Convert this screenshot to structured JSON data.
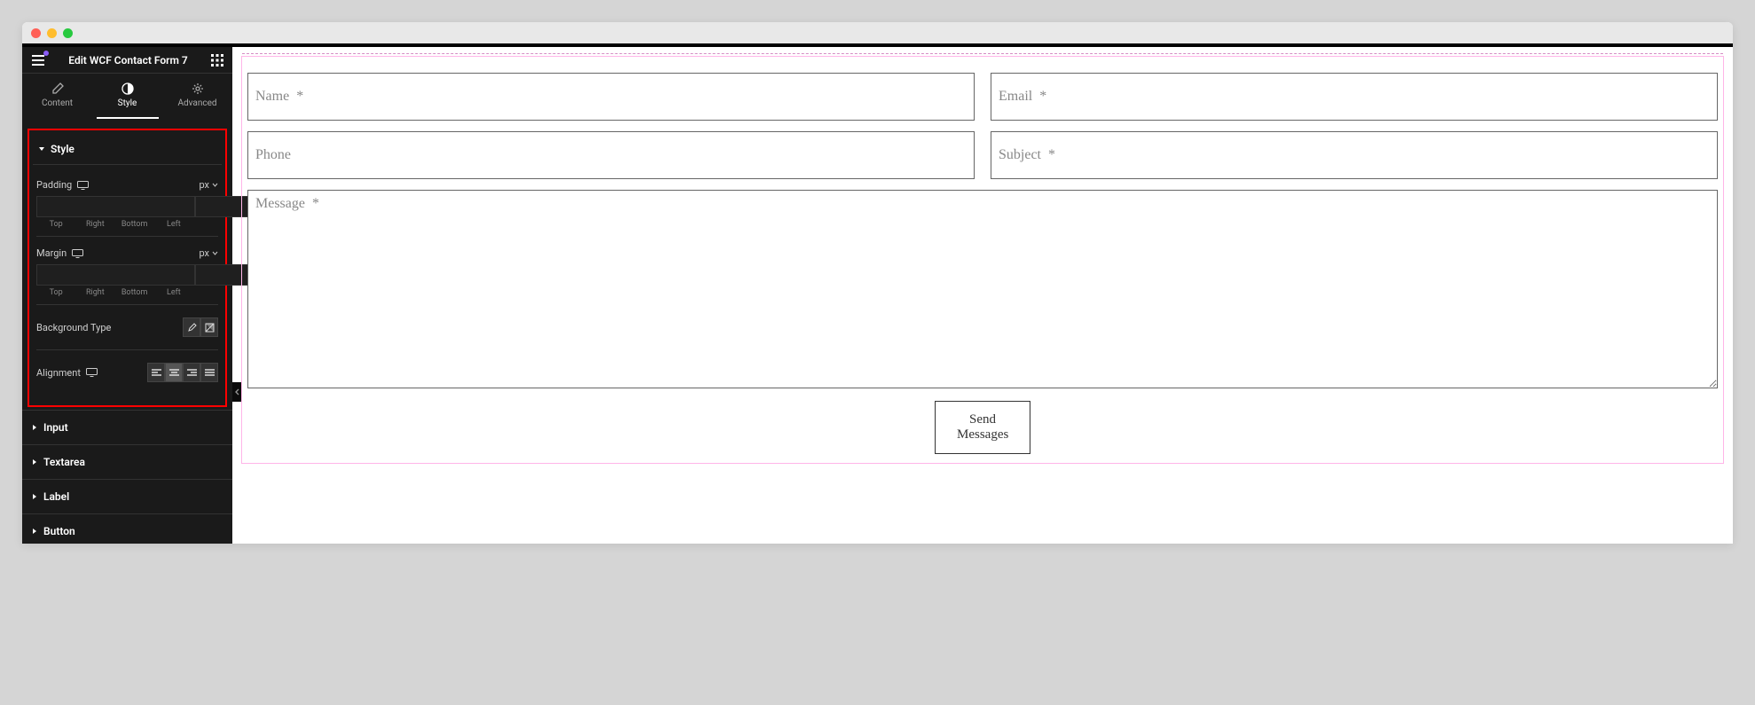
{
  "header": {
    "title": "Edit WCF Contact Form 7"
  },
  "tabs": {
    "content": "Content",
    "style": "Style",
    "advanced": "Advanced"
  },
  "style_section": {
    "title": "Style",
    "padding": {
      "label": "Padding",
      "unit": "px",
      "sides": {
        "top": "Top",
        "right": "Right",
        "bottom": "Bottom",
        "left": "Left"
      }
    },
    "margin": {
      "label": "Margin",
      "unit": "px",
      "sides": {
        "top": "Top",
        "right": "Right",
        "bottom": "Bottom",
        "left": "Left"
      }
    },
    "background_type": "Background Type",
    "alignment": "Alignment"
  },
  "accordions": {
    "input": "Input",
    "textarea": "Textarea",
    "label": "Label",
    "button": "Button"
  },
  "form": {
    "name": "Name  *",
    "email": "Email  *",
    "phone": "Phone",
    "subject": "Subject  *",
    "message": "Message  *",
    "submit": "Send Messages"
  }
}
